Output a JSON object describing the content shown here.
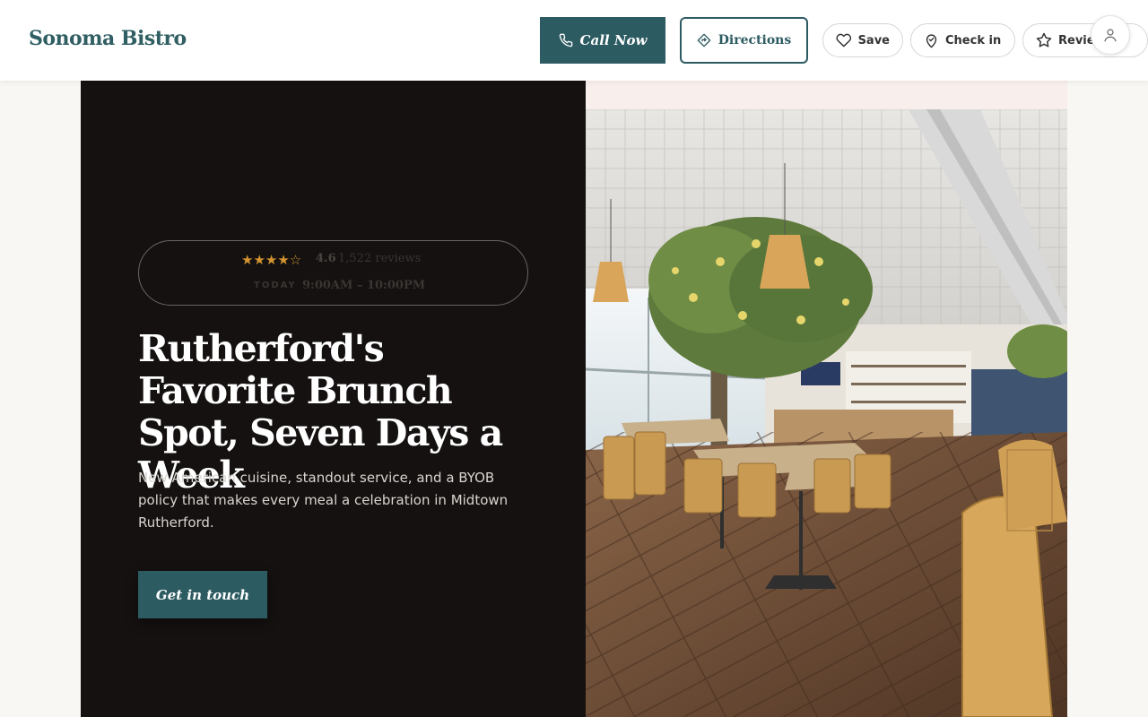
{
  "header": {
    "brand": "Sonoma Bistro",
    "call_label": "Call Now",
    "directions_label": "Directions",
    "save_label": "Save",
    "checkin_label": "Check in",
    "review_label": "Review"
  },
  "hero": {
    "stars": "★★★★☆",
    "rating": "4.6",
    "review_count": "1,522 reviews",
    "today_label": "TODAY",
    "hours": "9:00AM – 10:00PM",
    "headline": "Rutherford's Favorite Brunch Spot, Seven Days a Week",
    "subtext": "New American cuisine, standout service, and a BYOB policy that makes every meal a celebration in Midtown Rutherford.",
    "cta_label": "Get in touch"
  },
  "icons": {
    "call": "phone-icon",
    "directions": "directions-icon",
    "save": "heart-icon",
    "checkin": "map-pin-icon",
    "review": "star-icon",
    "avatar": "user-icon"
  },
  "colors": {
    "accent": "#2d5b62",
    "hero_bg": "#141110",
    "star": "#d3952f"
  }
}
